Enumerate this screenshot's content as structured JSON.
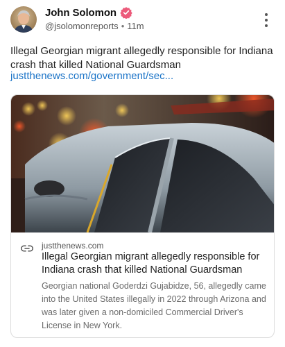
{
  "post": {
    "author": {
      "name": "John Solomon",
      "handle": "@jsolomonreports",
      "separator": "•",
      "time": "11m",
      "verified_icon": "verified-badge-icon",
      "verified_color": "#ec5a7a"
    },
    "more_icon": "more-vertical-icon",
    "text": "Illegal Georgian migrant allegedly responsible for Indiana crash that killed National Guardsman",
    "link_text": "justthenews.com/government/sec...",
    "link_color": "#1a73c7",
    "card": {
      "icon": "link-icon",
      "domain": "justthenews.com",
      "title": "Illegal Georgian migrant allegedly responsible for Indiana crash that killed National Guardsman",
      "description": "Georgian national Goderdzi Gujabidze, 56, allegedly came into the United States illegally in 2022 through Arizona and was later given a non-domiciled Commercial Driver's License in New York."
    }
  }
}
